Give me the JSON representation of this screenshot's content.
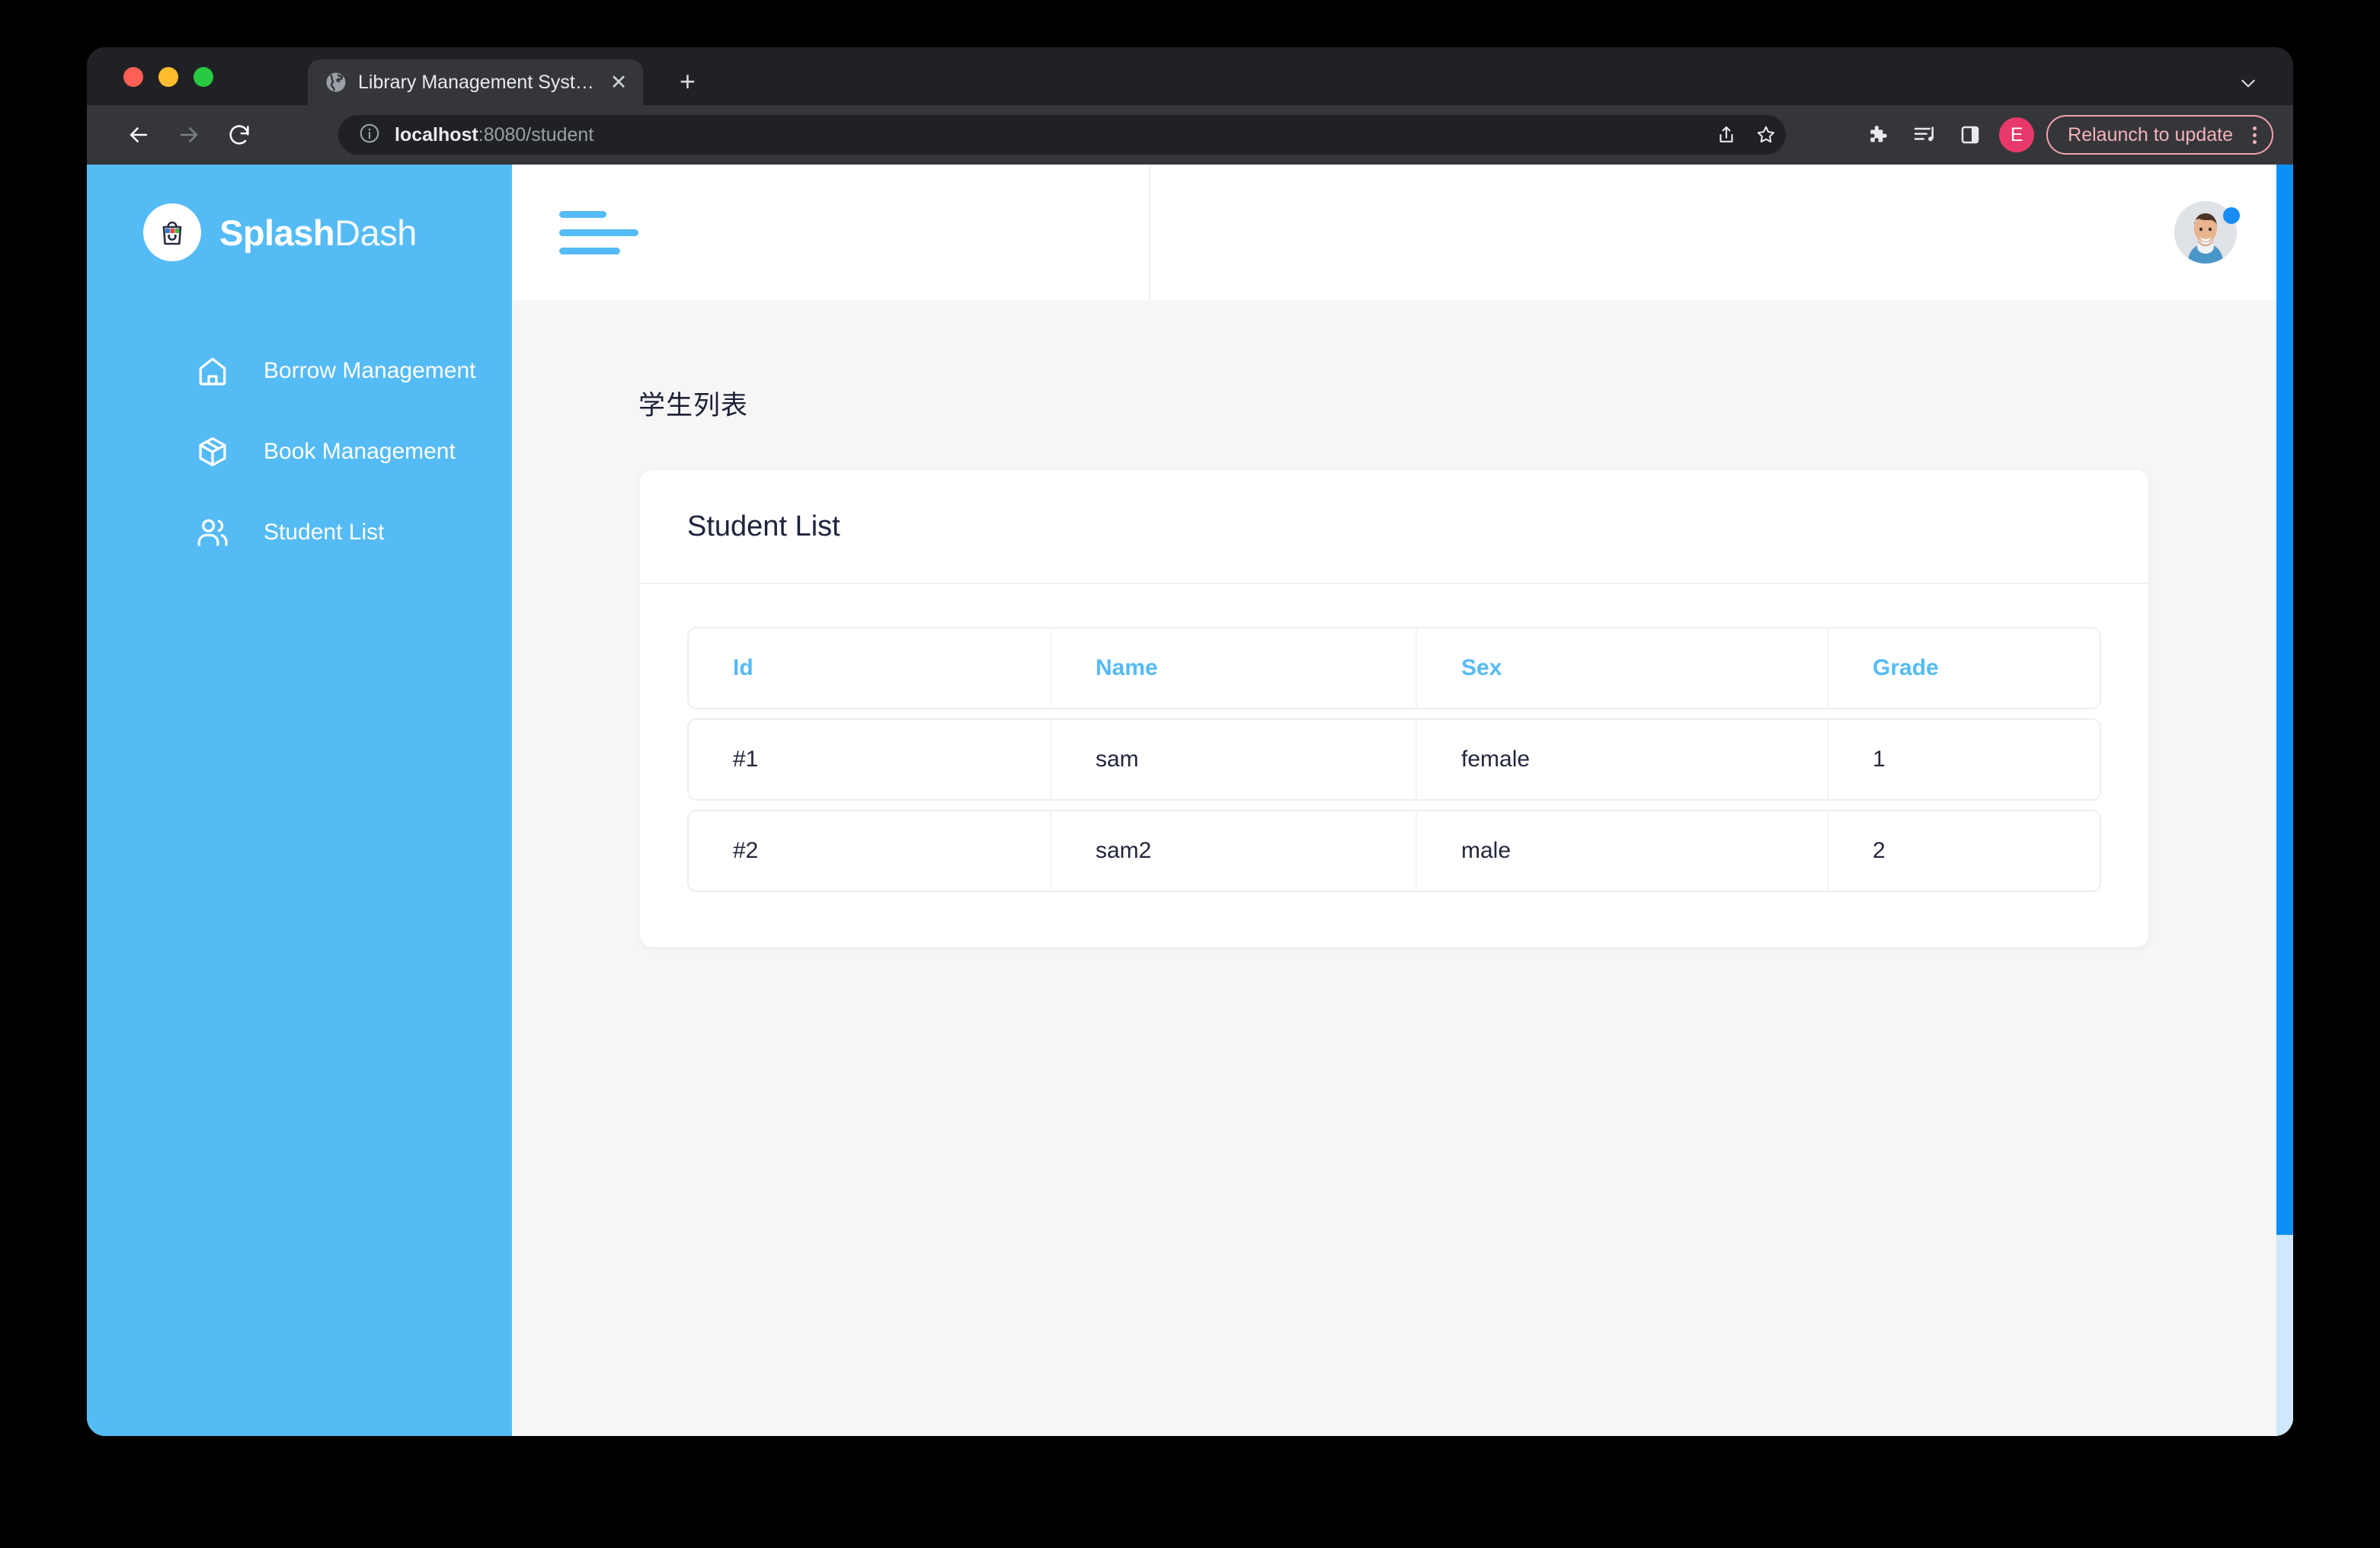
{
  "browser": {
    "tab": {
      "title": "Library Management System",
      "favicon": "globe-icon",
      "close": "✕"
    },
    "new_tab_label": "+",
    "omnibox": {
      "host": "localhost",
      "rest": ":8080/student",
      "info_icon": "info-circle-icon"
    },
    "toolbar": {
      "back_icon": "back-arrow-icon",
      "forward_icon": "forward-arrow-icon",
      "reload_icon": "reload-icon",
      "share_icon": "share-icon",
      "bookmark_icon": "star-icon",
      "extensions_icon": "puzzle-piece-icon",
      "reading_list_icon": "playlist-icon",
      "side_panel_icon": "side-panel-icon",
      "profile_initial": "E",
      "relaunch_label": "Relaunch to update",
      "menu_icon": "kebab-menu-icon"
    },
    "colors": {
      "chrome_bg": "#202124",
      "toolbar_bg": "#35363a",
      "relaunch_accent": "#f5b2ba",
      "profile_chip": "#e8396a"
    }
  },
  "app": {
    "brand": {
      "name_bold": "Splash",
      "name_light": "Dash",
      "logo_icon": "shopping-bag-icon"
    },
    "sidebar": {
      "items": [
        {
          "label": "Borrow Management",
          "icon": "home-icon"
        },
        {
          "label": "Book Management",
          "icon": "package-box-icon"
        },
        {
          "label": "Student List",
          "icon": "users-icon"
        }
      ],
      "color": "#55bbf5"
    },
    "header": {
      "menu_toggle_icon": "hamburger-icon",
      "avatar_icon": "user-avatar-photo",
      "status_dot_color": "#1a8cf5"
    },
    "main": {
      "page_title": "学生列表",
      "card": {
        "title": "Student List",
        "table": {
          "columns": [
            "Id",
            "Name",
            "Sex",
            "Grade"
          ],
          "rows": [
            {
              "id": "#1",
              "name": "sam",
              "sex": "female",
              "grade": "1"
            },
            {
              "id": "#2",
              "name": "sam2",
              "sex": "male",
              "grade": "2"
            }
          ]
        }
      }
    },
    "scrollbar": {
      "thumb_color": "#0b8ff5",
      "track_color": "#cfe8fd"
    }
  }
}
